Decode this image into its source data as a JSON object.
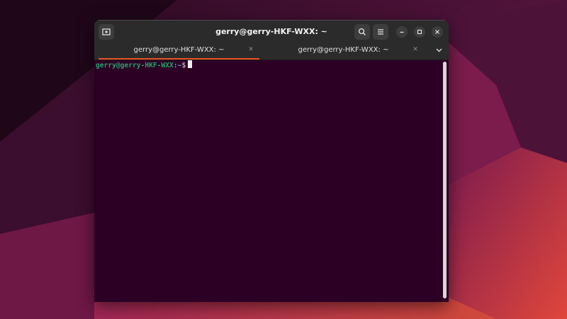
{
  "window": {
    "title": "gerry@gerry-HKF-WXX: ~"
  },
  "tabs": [
    {
      "label": "gerry@gerry-HKF-WXX: ~",
      "active": true
    },
    {
      "label": "gerry@gerry-HKF-WXX: ~",
      "active": false
    }
  ],
  "terminal": {
    "user_host": "gerry@gerry-HKF-WXX",
    "separator": ":",
    "path": "~",
    "prompt_symbol": "$"
  },
  "icons": {
    "new_tab": "new-tab-icon",
    "search": "search-icon",
    "menu": "hamburger-menu-icon",
    "minimize": "minimize-icon",
    "maximize": "maximize-icon",
    "close": "close-icon",
    "tab_close": "close-icon",
    "tab_dropdown": "chevron-down-icon"
  },
  "colors": {
    "terminal_background": "#2c0025",
    "titlebar": "#2b2b2b",
    "active_tab_underline": "#e95420",
    "prompt_user": "#26a269",
    "prompt_path": "#6a9fd8"
  }
}
